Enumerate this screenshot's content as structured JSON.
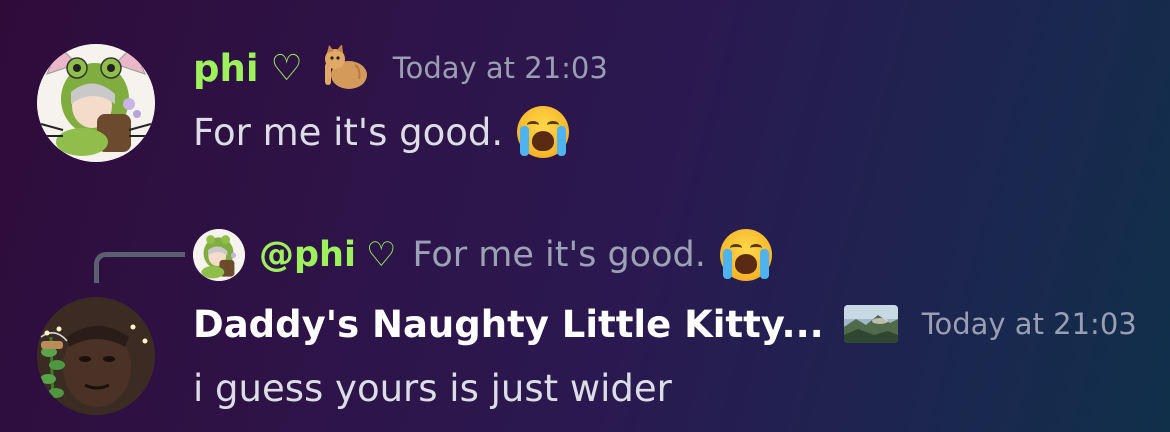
{
  "message1": {
    "username": "phi",
    "heart": "♡",
    "timestamp": "Today at 21:03",
    "content": "For me it's good.",
    "username_color": "#9df25c",
    "badge_icon": "cat-sticker-icon",
    "emoji": "loudly-crying-face-icon"
  },
  "reply": {
    "username": "@phi",
    "heart": "♡",
    "content": "For me it's good.",
    "username_color": "#9df25c",
    "emoji": "loudly-crying-face-icon"
  },
  "message2": {
    "username": "Daddy's Naughty Little Kitty...",
    "timestamp": "Today at 21:03",
    "content": "i guess yours is just wider",
    "username_color": "#ffffff",
    "badge_icon": "landscape-image-icon"
  }
}
